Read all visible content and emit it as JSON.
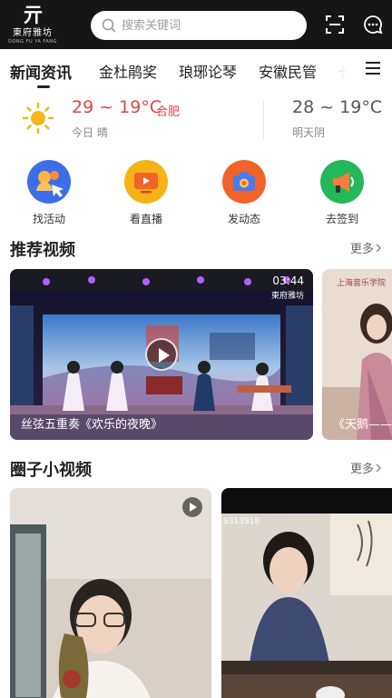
{
  "header": {
    "logo_mark": "亓",
    "logo_text": "東府雅坊",
    "logo_sub": "DONG FU YA FANG",
    "search_placeholder": "搜索关键词"
  },
  "tabs": [
    {
      "label": "新闻资讯",
      "active": true
    },
    {
      "label": "金杜鹃奖",
      "active": false
    },
    {
      "label": "琅琊论琴",
      "active": false
    },
    {
      "label": "安徽民管",
      "active": false
    },
    {
      "label": "长",
      "active": false
    }
  ],
  "weather": {
    "today": {
      "temp": "29 ~ 19°C",
      "city": "合肥",
      "label": "今日 晴",
      "icon": "sun-icon"
    },
    "tomorrow": {
      "temp": "28 ~ 19°C",
      "label": "明天阴"
    }
  },
  "quick_actions": [
    {
      "label": "找活动",
      "icon": "find-activity-icon",
      "color": "#3d6ee8"
    },
    {
      "label": "看直播",
      "icon": "live-tv-icon",
      "color": "#f5b317"
    },
    {
      "label": "发动态",
      "icon": "post-camera-icon",
      "color": "#f0642a"
    },
    {
      "label": "去签到",
      "icon": "checkin-megaphone-icon",
      "color": "#23b85a"
    }
  ],
  "recommended": {
    "title": "推荐视频",
    "more": "更多",
    "videos": [
      {
        "title": "丝弦五重奏《欢乐的夜晚》",
        "duration": "03:44",
        "watermark": "東府雅坊"
      },
      {
        "title": "《天鹅——",
        "watermark": "上海音乐学院"
      }
    ]
  },
  "circle": {
    "title": "圈子小视频",
    "more": "更多",
    "videos": [
      {
        "overlay": ""
      },
      {
        "overlay": "9313918"
      }
    ]
  }
}
